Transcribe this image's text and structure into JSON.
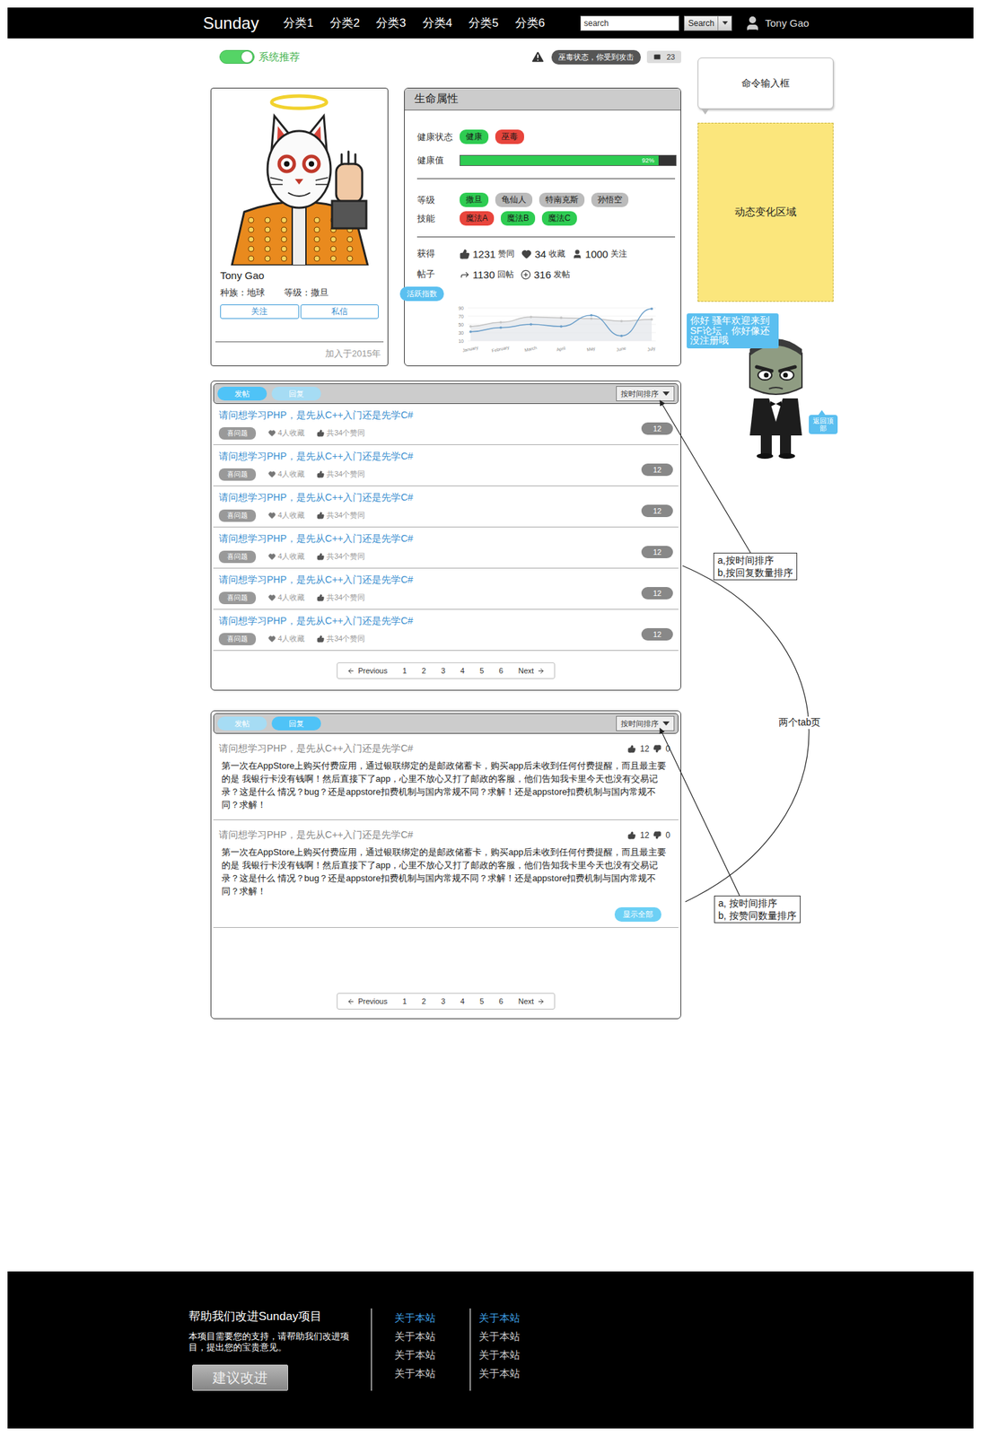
{
  "header": {
    "logo": "Sunday",
    "nav": [
      {
        "label": "分类1"
      },
      {
        "label": "分类2"
      },
      {
        "label": "分类3"
      },
      {
        "label": "分类4"
      },
      {
        "label": "分类5"
      },
      {
        "label": "分类6"
      }
    ],
    "search": {
      "placeholder": "search",
      "button": "Search"
    },
    "user": "Tony Gao"
  },
  "recommend_toggle": {
    "label": "系统推荐",
    "on": true
  },
  "alert": {
    "text": "巫毒状态，你受到攻击"
  },
  "messages": {
    "count": "23"
  },
  "profile": {
    "name": "Tony Gao",
    "race": "种族：地球",
    "rank": "等级：撒旦",
    "buttons": [
      "关注",
      "私信"
    ],
    "joined": "加入于2015年"
  },
  "life": {
    "title": "生命属性",
    "health_label": "健康状态",
    "health_tags": [
      {
        "label": "健康",
        "color": "#2ecc52"
      },
      {
        "label": "巫毒",
        "color": "#e8453c"
      }
    ],
    "hp_label": "健康值",
    "hp_level": 0.92,
    "hp_reading": "92%",
    "level_label": "等级",
    "levels": [
      {
        "label": "撒旦",
        "color": "#2ecc52"
      },
      {
        "label": "龟仙人",
        "color": "#bbbbbb"
      },
      {
        "label": "特南克斯",
        "color": "#bbbbbb"
      },
      {
        "label": "孙悟空",
        "color": "#bbbbbb"
      }
    ],
    "skill_label": "技能",
    "skills": [
      {
        "label": "魔法A",
        "color": "#e8453c"
      },
      {
        "label": "魔法B",
        "color": "#2ecc52"
      },
      {
        "label": "魔法C",
        "color": "#2ecc52"
      }
    ],
    "gain_label": "获得",
    "gains": [
      {
        "value": "1231",
        "label": "赞同"
      },
      {
        "value": "34",
        "label": "收藏"
      },
      {
        "value": "1000",
        "label": "关注"
      }
    ],
    "posts_label": "帖子",
    "posts": [
      {
        "value": "1130",
        "label": "回帖"
      },
      {
        "value": "316",
        "label": "发帖"
      }
    ]
  },
  "activity_chart": {
    "title": "活跃指数",
    "y_ticks": [
      "90",
      "70",
      "50",
      "30",
      "10"
    ],
    "x_labels": [
      "January",
      "February",
      "March",
      "April",
      "May",
      "June",
      "July"
    ],
    "series": [
      {
        "values": [
          45,
          55,
          68,
          66,
          64,
          58,
          62
        ],
        "color": "#c4c4c4"
      },
      {
        "values": [
          32,
          42,
          50,
          45,
          72,
          22,
          88
        ],
        "color": "#6a9ec9"
      }
    ]
  },
  "command_box": {
    "label": "命令输入框"
  },
  "dynamic_area": {
    "label": "动态变化区域"
  },
  "mascot": {
    "greeting": "你好 骚年欢迎来到SF论坛，你好像还没注册哦",
    "back_to_top": "返回顶部"
  },
  "question_list": {
    "tabs": [
      {
        "label": "发帖",
        "selected": true
      },
      {
        "label": "回复",
        "selected": false
      }
    ],
    "sort": "按时间排序",
    "rows": [
      {
        "title": "请问想学习PHP，是先从C++入门还是先学C#",
        "tag": "喜问题",
        "favorites": "4人收藏",
        "likes": "共34个赞同",
        "count": "12"
      },
      {
        "title": "请问想学习PHP，是先从C++入门还是先学C#",
        "tag": "喜问题",
        "favorites": "4人收藏",
        "likes": "共34个赞同",
        "count": "12"
      },
      {
        "title": "请问想学习PHP，是先从C++入门还是先学C#",
        "tag": "喜问题",
        "favorites": "4人收藏",
        "likes": "共34个赞同",
        "count": "12"
      },
      {
        "title": "请问想学习PHP，是先从C++入门还是先学C#",
        "tag": "喜问题",
        "favorites": "4人收藏",
        "likes": "共34个赞同",
        "count": "12"
      },
      {
        "title": "请问想学习PHP，是先从C++入门还是先学C#",
        "tag": "喜问题",
        "favorites": "4人收藏",
        "likes": "共34个赞同",
        "count": "12"
      },
      {
        "title": "请问想学习PHP，是先从C++入门还是先学C#",
        "tag": "喜问题",
        "favorites": "4人收藏",
        "likes": "共34个赞同",
        "count": "12"
      }
    ],
    "pagination": {
      "previous": "Previous",
      "pages": [
        "1",
        "2",
        "3",
        "4",
        "5",
        "6"
      ],
      "next": "Next"
    }
  },
  "reply_list": {
    "tabs": [
      {
        "label": "发帖",
        "selected": false
      },
      {
        "label": "回复",
        "selected": true
      }
    ],
    "sort": "按时间排序",
    "rows": [
      {
        "title": "请问想学习PHP，是先从C++入门还是先学C#",
        "up": "12",
        "down": "0",
        "body": "第一次在AppStore上购买付费应用，通过银联绑定的是邮政储蓄卡，购买app后未收到任何付费提醒，而且最主要的是 我银行卡没有钱啊！然后直接下了app，心里不放心又打了邮政的客服，他们告知我卡里今天也没有交易记录？这是什么 情况？bug？还是appstore扣费机制与国内常规不同？求解！还是appstore扣费机制与国内常规不同？求解！"
      },
      {
        "title": "请问想学习PHP，是先从C++入门还是先学C#",
        "up": "12",
        "down": "0",
        "body": "第一次在AppStore上购买付费应用，通过银联绑定的是邮政储蓄卡，购买app后未收到任何付费提醒，而且最主要的是 我银行卡没有钱啊！然后直接下了app，心里不放心又打了邮政的客服，他们告知我卡里今天也没有交易记录？这是什么 情况？bug？还是appstore扣费机制与国内常规不同？求解！还是appstore扣费机制与国内常规不同？求解！"
      }
    ],
    "show_all": "显示全部",
    "pagination": {
      "previous": "Previous",
      "pages": [
        "1",
        "2",
        "3",
        "4",
        "5",
        "6"
      ],
      "next": "Next"
    }
  },
  "annotations": {
    "notes": [
      {
        "lines": [
          "a,按时间排序",
          "b,按回复数量排序"
        ]
      },
      {
        "lines": [
          "a, 按时间排序",
          "b, 按赞同数量排序"
        ]
      }
    ],
    "tab_note": "两个tab页"
  },
  "footer": {
    "title": "帮助我们改进Sunday项目",
    "text": "本项目需要您的支持，请帮助我们改进项目，提出您的宝贵意见。",
    "button": "建议改进",
    "columns": [
      {
        "items": [
          {
            "label": "关于本站",
            "highlighted": true
          },
          {
            "label": "关于本站",
            "highlighted": false
          },
          {
            "label": "关于本站",
            "highlighted": false
          },
          {
            "label": "关于本站",
            "highlighted": false
          }
        ]
      },
      {
        "items": [
          {
            "label": "关于本站",
            "highlighted": true
          },
          {
            "label": "关于本站",
            "highlighted": false
          },
          {
            "label": "关于本站",
            "highlighted": false
          },
          {
            "label": "关于本站",
            "highlighted": false
          }
        ]
      }
    ]
  }
}
